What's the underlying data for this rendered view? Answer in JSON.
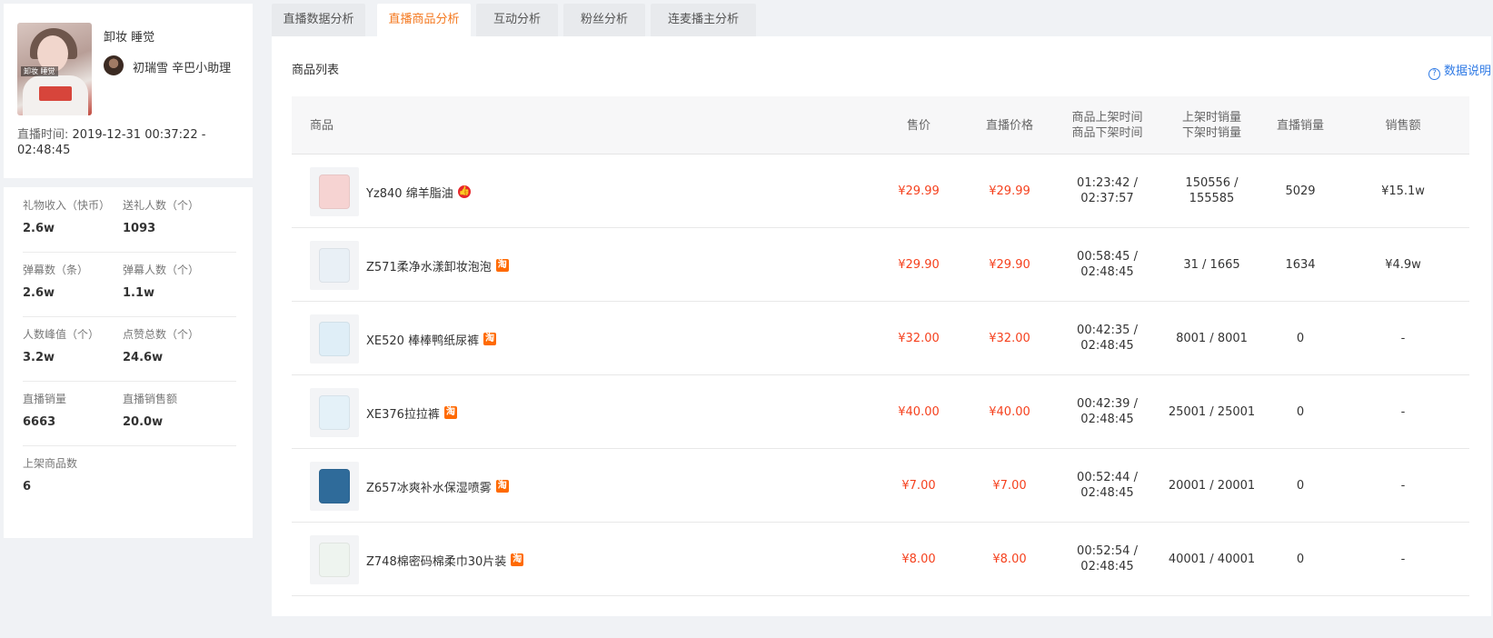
{
  "room": {
    "cover_tag": "卸妆 睡觉",
    "title": "卸妆 睡觉",
    "anchor_name": "初瑞雪 辛巴小助理",
    "live_time_label": "直播时间:",
    "live_time_value": "2019-12-31 00:37:22 - 02:48:45"
  },
  "stats": [
    {
      "label": "礼物收入（快币）",
      "value": "2.6w"
    },
    {
      "label": "送礼人数（个）",
      "value": "1093"
    },
    {
      "label": "弹幕数（条）",
      "value": "2.6w"
    },
    {
      "label": "弹幕人数（个）",
      "value": "1.1w"
    },
    {
      "label": "人数峰值（个）",
      "value": "3.2w"
    },
    {
      "label": "点赞总数（个）",
      "value": "24.6w"
    },
    {
      "label": "直播销量",
      "value": "6663"
    },
    {
      "label": "直播销售额",
      "value": "20.0w"
    },
    {
      "label": "上架商品数",
      "value": "6"
    }
  ],
  "tabs": [
    {
      "label": "直播数据分析",
      "active": false
    },
    {
      "label": "直播商品分析",
      "active": true
    },
    {
      "label": "互动分析",
      "active": false
    },
    {
      "label": "粉丝分析",
      "active": false
    },
    {
      "label": "连麦播主分析",
      "active": false
    }
  ],
  "section_title": "商品列表",
  "help_label": "数据说明",
  "help_icon": "?",
  "columns": {
    "product": "商品",
    "price": "售价",
    "live_price": "直播价格",
    "time_line1": "商品上架时间",
    "time_line2": "商品下架时间",
    "stock_line1": "上架时销量",
    "stock_line2": "下架时销量",
    "live_sales": "直播销量",
    "revenue": "销售额"
  },
  "products": [
    {
      "name": "Yz840 绵羊脂油",
      "badge": "kuaishou-badge-icon",
      "badge_glyph": "👍",
      "price": "¥29.99",
      "live_price": "¥29.99",
      "time_on": "01:23:42 /",
      "time_off": "02:37:57",
      "sales_on": "150556 /",
      "sales_off": "155585",
      "live_sales": "5029",
      "revenue": "¥15.1w",
      "thumb_color": "#f6d3d2"
    },
    {
      "name": "Z571柔净水漾卸妆泡泡",
      "badge": "taobao-badge-icon",
      "badge_glyph": "淘",
      "price": "¥29.90",
      "live_price": "¥29.90",
      "time_on": "00:58:45 /",
      "time_off": "02:48:45",
      "sales_on": "31 / 1665",
      "sales_off": "",
      "live_sales": "1634",
      "revenue": "¥4.9w",
      "thumb_color": "#e9f0f6"
    },
    {
      "name": "XE520 棒棒鸭纸尿裤",
      "badge": "taobao-badge-icon",
      "badge_glyph": "淘",
      "price": "¥32.00",
      "live_price": "¥32.00",
      "time_on": "00:42:35 /",
      "time_off": "02:48:45",
      "sales_on": "8001 / 8001",
      "sales_off": "",
      "live_sales": "0",
      "revenue": "-",
      "thumb_color": "#dfeef7"
    },
    {
      "name": "XE376拉拉裤",
      "badge": "taobao-badge-icon",
      "badge_glyph": "淘",
      "price": "¥40.00",
      "live_price": "¥40.00",
      "time_on": "00:42:39 /",
      "time_off": "02:48:45",
      "sales_on": "25001 / 25001",
      "sales_off": "",
      "live_sales": "0",
      "revenue": "-",
      "thumb_color": "#e4f1f8"
    },
    {
      "name": "Z657冰爽补水保湿喷雾",
      "badge": "taobao-badge-icon",
      "badge_glyph": "淘",
      "price": "¥7.00",
      "live_price": "¥7.00",
      "time_on": "00:52:44 /",
      "time_off": "02:48:45",
      "sales_on": "20001 / 20001",
      "sales_off": "",
      "live_sales": "0",
      "revenue": "-",
      "thumb_color": "#2f6b9a"
    },
    {
      "name": "Z748棉密码棉柔巾30片装",
      "badge": "taobao-badge-icon",
      "badge_glyph": "淘",
      "price": "¥8.00",
      "live_price": "¥8.00",
      "time_on": "00:52:54 /",
      "time_off": "02:48:45",
      "sales_on": "40001 / 40001",
      "sales_off": "",
      "live_sales": "0",
      "revenue": "-",
      "thumb_color": "#eef4ef"
    }
  ]
}
